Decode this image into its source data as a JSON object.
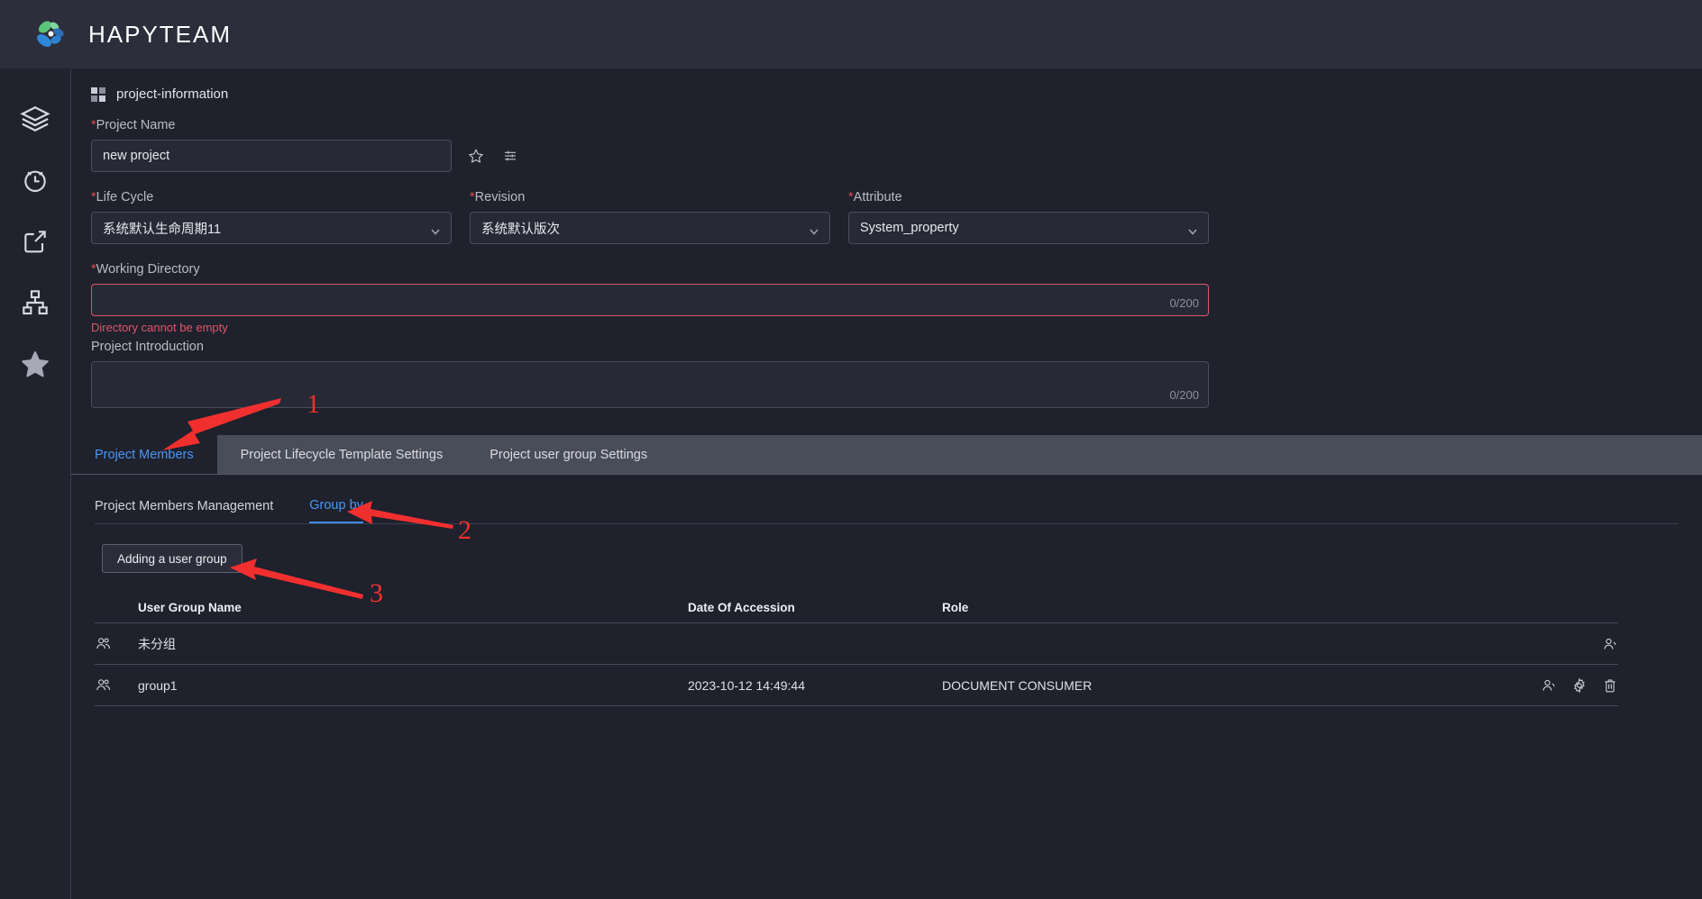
{
  "app": {
    "brand": "HAPYTEAM",
    "logo_colors": [
      "#49b56b",
      "#2f87d8",
      "#2f6fc0"
    ]
  },
  "sidebar": {
    "items": [
      {
        "name": "layers-icon",
        "label": "Layers"
      },
      {
        "name": "clock-icon",
        "label": "History"
      },
      {
        "name": "share-icon",
        "label": "Share"
      },
      {
        "name": "sitemap-icon",
        "label": "Structure"
      },
      {
        "name": "star-icon",
        "label": "Favorites"
      }
    ]
  },
  "panel": {
    "title": "project-information"
  },
  "form": {
    "project_name": {
      "label": "Project Name",
      "required": true,
      "value": "new project",
      "placeholder": ""
    },
    "life_cycle": {
      "label": "Life Cycle",
      "required": true,
      "value": "系统默认生命周期11"
    },
    "revision": {
      "label": "Revision",
      "required": true,
      "value": "系统默认版次"
    },
    "attribute": {
      "label": "Attribute",
      "required": true,
      "value": "System_property"
    },
    "working_directory": {
      "label": "Working Directory",
      "required": true,
      "value": "",
      "counter": "0/200",
      "error": "Directory cannot be empty"
    },
    "project_introduction": {
      "label": "Project Introduction",
      "required": false,
      "value": "",
      "counter": "0/200"
    }
  },
  "tabs": [
    {
      "label": "Project Members",
      "active": true
    },
    {
      "label": "Project Lifecycle Template Settings",
      "active": false
    },
    {
      "label": "Project user group Settings",
      "active": false
    }
  ],
  "subtabs": [
    {
      "label": "Project Members Management",
      "active": false
    },
    {
      "label": "Group by",
      "active": true
    }
  ],
  "actions": {
    "add_user_group": "Adding a user group"
  },
  "table": {
    "columns": [
      "User Group Name",
      "Date Of Accession",
      "Role"
    ],
    "rows": [
      {
        "group_name": "未分组",
        "date": "",
        "role": "",
        "actions": [
          "user-icon"
        ]
      },
      {
        "group_name": "group1",
        "date": "2023-10-12 14:49:44",
        "role": "DOCUMENT CONSUMER",
        "actions": [
          "user-icon",
          "gear-icon",
          "trash-icon"
        ]
      }
    ]
  },
  "annotations": [
    {
      "number": "1",
      "target": "Project Members tab"
    },
    {
      "number": "2",
      "target": "Group by subtab"
    },
    {
      "number": "3",
      "target": "Adding a user group button"
    }
  ],
  "colors": {
    "accent": "#4a97f7",
    "error": "#e0566b",
    "annotation": "#f22f2f"
  }
}
